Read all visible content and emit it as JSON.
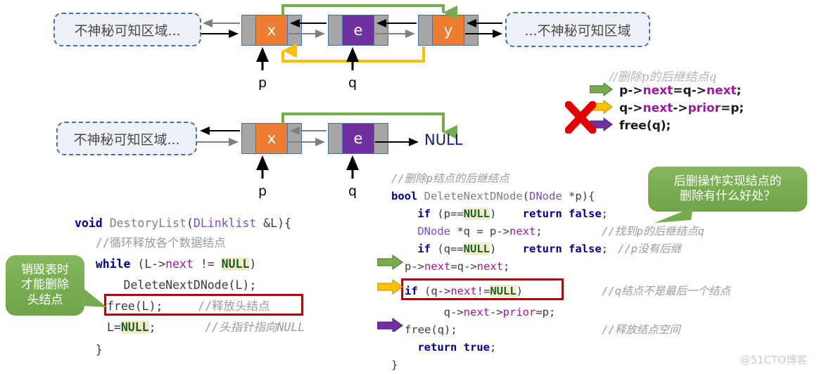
{
  "diagram1": {
    "left_region": "不神秘可知区域...",
    "right_region": "...不神秘可知区域",
    "nodes": [
      {
        "value": "x",
        "color": "orange"
      },
      {
        "value": "e",
        "color": "purple"
      },
      {
        "value": "y",
        "color": "orange"
      }
    ],
    "pointer_labels": [
      "p",
      "q"
    ]
  },
  "diagram2": {
    "left_region": "不神秘可知区域...",
    "nodes": [
      {
        "value": "x",
        "color": "orange"
      },
      {
        "value": "e",
        "color": "purple"
      }
    ],
    "null_label": "NULL",
    "pointer_labels": [
      "p",
      "q"
    ]
  },
  "ops_panel": {
    "comment": "//删除p的后继结点q",
    "statements": [
      {
        "arrow_color": "#76ab4e",
        "text_parts": [
          {
            "t": "p-",
            "c": "plainb"
          },
          {
            "t": ">",
            "c": "plainb"
          },
          {
            "t": "next",
            "c": "memb"
          },
          {
            "t": "=q-",
            "c": "plainb"
          },
          {
            "t": ">",
            "c": "plainb"
          },
          {
            "t": "next",
            "c": "memb"
          },
          {
            "t": ";",
            "c": "plainb"
          }
        ]
      },
      {
        "arrow_color": "#ffc000",
        "text_parts": [
          {
            "t": "q-",
            "c": "plainb"
          },
          {
            "t": ">",
            "c": "plainb"
          },
          {
            "t": "next",
            "c": "memb"
          },
          {
            "t": "-",
            "c": "plainb"
          },
          {
            "t": ">",
            "c": "plainb"
          },
          {
            "t": "prior",
            "c": "memb"
          },
          {
            "t": "=p;",
            "c": "plainb"
          }
        ]
      },
      {
        "arrow_color": "#7030a0",
        "text_parts": [
          {
            "t": "free(q);",
            "c": "plainb"
          }
        ]
      }
    ],
    "cross_mark": "red-x-mark"
  },
  "callout_left": {
    "lines": [
      "销毁表时",
      "才能删除",
      "头结点"
    ]
  },
  "callout_right": {
    "lines": [
      "后删操作实现结点的",
      "删除有什么好处？"
    ]
  },
  "code_left": {
    "lines": [
      "void DestoryList(DLinklist &L){",
      "    //循环释放各个数据结点",
      "    while (L->next != NULL)",
      "        DeleteNextDNode(L);",
      "    free(L);      //释放头结点",
      "    L=NULL;        //头指针指向NULL",
      "}"
    ]
  },
  "code_right": {
    "lines": [
      "//删除p结点的后继结点",
      "bool DeleteNextDNode(DNode *p){",
      "    if (p==NULL)    return false;",
      "    DNode *q = p->next;      //找到p的后继结点q",
      "    if (q==NULL)    return false;    //p没有后继",
      "p->next=q->next;",
      "if (q->next!=NULL)        //q结点不是最后一个结点",
      "        q->next->prior=p;",
      "free(q);                //释放结点空间",
      "    return true;",
      "}"
    ],
    "comments": {
      "find_successor": "//找到p的后继结点q",
      "no_successor": "//p没有后继",
      "not_last": "//q结点不是最后一个结点",
      "free_space": "//释放结点空间"
    }
  },
  "watermark": "@51CTO博客",
  "colors": {
    "node_value_orange": "#ed7d31",
    "node_value_purple": "#7030a0",
    "node_pointer_gray": "#a6a6a6",
    "node_border_blue": "#4472a8",
    "green_arrow": "#76ab4e",
    "orange_arrow": "#ffc000",
    "purple_arrow": "#7030a0",
    "red_highlight": "#9e0f10",
    "callout_green": "#76ab4e"
  }
}
